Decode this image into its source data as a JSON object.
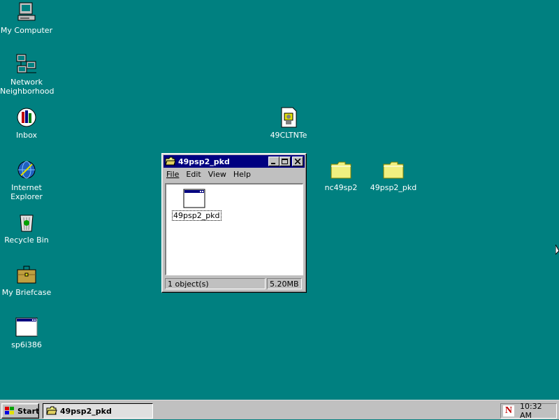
{
  "desktop": {
    "background_color": "#008080",
    "icons": [
      {
        "label": "My Computer",
        "icon": "computer-icon"
      },
      {
        "label": "Network\nNeighborhood",
        "icon": "network-icon"
      },
      {
        "label": "Inbox",
        "icon": "inbox-icon"
      },
      {
        "label": "Internet\nExplorer",
        "icon": "internet-explorer-icon"
      },
      {
        "label": "Recycle Bin",
        "icon": "recycle-bin-icon"
      },
      {
        "label": "My Briefcase",
        "icon": "briefcase-icon"
      },
      {
        "label": "sp6i386",
        "icon": "program-icon"
      },
      {
        "label": "49CLTNTe",
        "icon": "installer-icon"
      },
      {
        "label": "nc49sp2",
        "icon": "folder-icon"
      },
      {
        "label": "49psp2_pkd",
        "icon": "folder-icon"
      }
    ]
  },
  "window": {
    "title": "49psp2_pkd",
    "menu": [
      "File",
      "Edit",
      "View",
      "Help"
    ],
    "items": [
      {
        "label": "49psp2_pkd",
        "icon": "program-icon"
      }
    ],
    "status_count": "1 object(s)",
    "status_size": "5.20MB"
  },
  "taskbar": {
    "start_label": "Start",
    "tasks": [
      {
        "label": "49psp2_pkd"
      }
    ],
    "tray_icon": "netscape-icon",
    "tray_letter": "N",
    "clock": "10:32 AM"
  }
}
